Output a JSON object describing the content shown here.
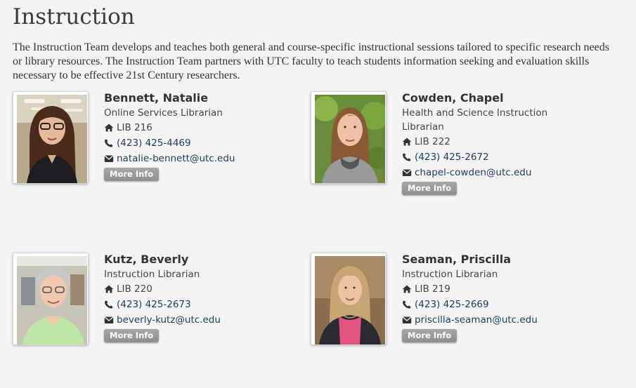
{
  "page": {
    "title": "Instruction",
    "intro": "The Instruction Team develops and teaches both general and course-specific instructional sessions tailored to specific research needs or library resources. The Instruction Team partners with UTC faculty to teach students information seeking and evaluation skills necessary to be effective 21st Century researchers."
  },
  "colors": {
    "background": "#f4f4f4",
    "link": "#1f3d63",
    "button": "#999999"
  },
  "staff": [
    {
      "name": "Bennett, Natalie",
      "title": "Online Services Librarian",
      "room_icon": "home-icon",
      "room": "LIB 216",
      "phone_icon": "phone-icon",
      "phone": "(423) 425-4469",
      "email_icon": "envelope-icon",
      "email": "natalie-bennett@utc.edu",
      "button": "More Info"
    },
    {
      "name": "Cowden, Chapel",
      "title": "Health and Science Instruction Librarian",
      "room_icon": "home-icon",
      "room": "LIB 222",
      "phone_icon": "phone-icon",
      "phone": "(423) 425-2672",
      "email_icon": "envelope-icon",
      "email": "chapel-cowden@utc.edu",
      "button": "More Info"
    },
    {
      "name": "Kutz, Beverly",
      "title": "Instruction Librarian",
      "room_icon": "home-icon",
      "room": "LIB 220",
      "phone_icon": "phone-icon",
      "phone": "(423) 425-2673",
      "email_icon": "envelope-icon",
      "email": "beverly-kutz@utc.edu",
      "button": "More Info"
    },
    {
      "name": "Seaman, Priscilla",
      "title": "Instruction Librarian",
      "room_icon": "home-icon",
      "room": "LIB 219",
      "phone_icon": "phone-icon",
      "phone": "(423) 425-2669",
      "email_icon": "envelope-icon",
      "email": "priscilla-seaman@utc.edu",
      "button": "More Info"
    }
  ]
}
